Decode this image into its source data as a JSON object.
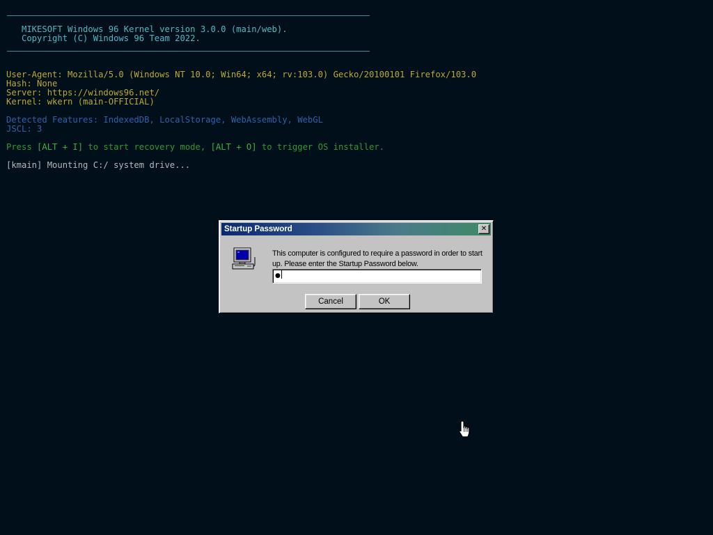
{
  "console": {
    "banner_line1": "   MIKESOFT Windows 96 Kernel version 3.0.0 (main/web).",
    "banner_line2": "   Copyright (C) Windows 96 Team 2022.",
    "user_agent": "User-Agent: Mozilla/5.0 (Windows NT 10.0; Win64; x64; rv:103.0) Gecko/20100101 Firefox/103.0",
    "hash": "Hash: None",
    "server": "Server: https://windows96.net/",
    "kernel": "Kernel: wkern (main-OFFICIAL)",
    "features": "Detected Features: IndexedDB, LocalStorage, WebAssembly, WebGL",
    "jscl": "JSCL: 3",
    "recovery_prefix": "Press ",
    "recovery_key1": "[ALT + I]",
    "recovery_middle": " to start recovery mode, ",
    "recovery_key2": "[ALT + O]",
    "recovery_suffix": " to trigger OS installer.",
    "mount": "[kmain] Mounting C:/ system drive..."
  },
  "dialog": {
    "title": "Startup Password",
    "close_glyph": "✕",
    "message": "This computer is configured to require a password in order to start up. Please enter the Startup Password below.",
    "password_value": "●",
    "cancel_label": "Cancel",
    "ok_label": "OK"
  },
  "icons": {
    "dialog_icon": "computer-icon",
    "cursor": "hand-pointer-icon"
  },
  "colors": {
    "background": "#010f1b",
    "banner": "#4fb9c2",
    "info": "#bdaa2f",
    "features": "#2e62a8",
    "recovery": "#2f9a33",
    "log": "#b4b8bc",
    "dialog_face": "#c3c3c3"
  }
}
